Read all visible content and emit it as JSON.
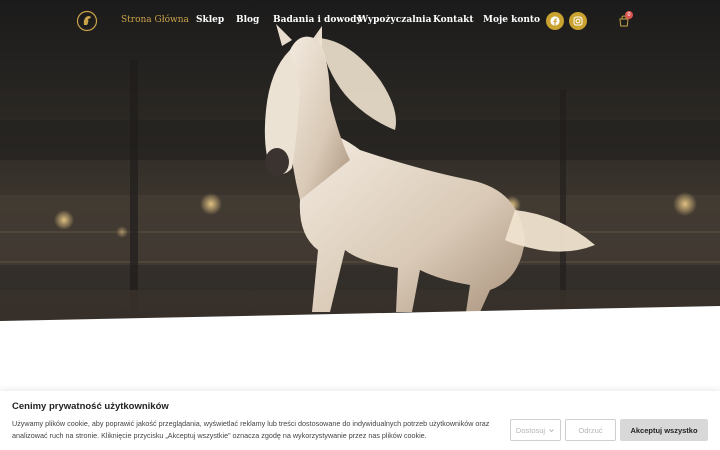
{
  "nav": {
    "items": [
      {
        "label": "Strona Główna",
        "active": true
      },
      {
        "label": "Sklep",
        "active": false
      },
      {
        "label": "Blog",
        "active": false
      },
      {
        "label": "Badania i dowody",
        "active": false
      },
      {
        "label": "Wypożyczalnia",
        "active": false
      },
      {
        "label": "Kontakt",
        "active": false
      },
      {
        "label": "Moje konto",
        "active": false
      }
    ],
    "social_icons": [
      "facebook-icon",
      "instagram-icon"
    ],
    "cart_count": "0"
  },
  "colors": {
    "accent": "#c9a24a",
    "social_bg": "#c9a22f",
    "badge": "#d9534f"
  },
  "cookie": {
    "title": "Cenimy prywatność użytkowników",
    "text": "Używamy plików cookie, aby poprawić jakość przeglądania, wyświetlać reklamy lub treści dostosowane do indywidualnych potrzeb użytkowników oraz analizować ruch na stronie. Kliknięcie przycisku „Akceptuj wszystkie” oznacza zgodę na wykorzystywanie przez nas plików cookie.",
    "customize_label": "Dostosuj",
    "reject_label": "Odrzuć",
    "accept_label": "Akceptuj wszystko"
  }
}
